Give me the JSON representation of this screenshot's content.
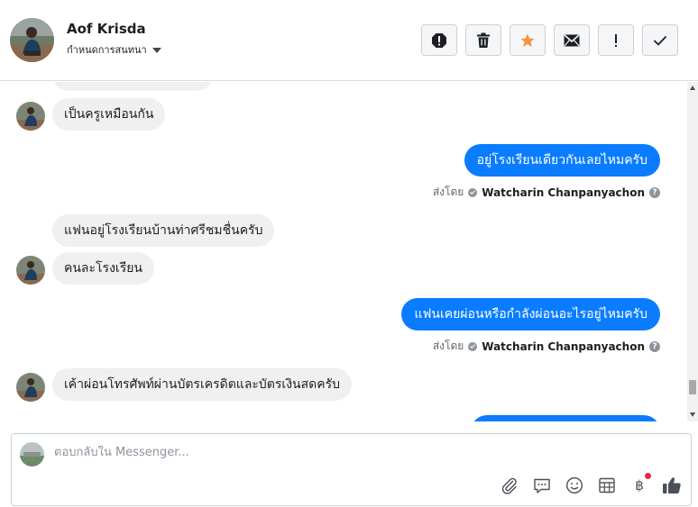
{
  "header": {
    "contact_name": "Aof Krisda",
    "status_label": "กำหนดการสนทนา",
    "toolbar": [
      "spam-icon",
      "trash-icon",
      "star-icon",
      "envelope-icon",
      "exclamation-icon",
      "check-icon"
    ]
  },
  "messages": [
    {
      "direction": "in",
      "text": "เป็นครูเหมือนกัน",
      "show_avatar": true
    },
    {
      "direction": "out",
      "text": "อยู่โรงเรียนเดียวกันเลยไหมครับ",
      "sent_by_label": "ส่งโดย",
      "sent_by_name": "Watcharin Chanpanyachon"
    },
    {
      "direction": "in",
      "text": "แฟนอยู่โรงเรียนบ้านท่าศรีชมชื่นครับ",
      "show_avatar": false
    },
    {
      "direction": "in",
      "text": "คนละโรงเรียน",
      "show_avatar": true
    },
    {
      "direction": "out",
      "text": "แฟนเคยผ่อนหรือกำลังผ่อนอะไรอยู่ไหมครับ",
      "sent_by_label": "ส่งโดย",
      "sent_by_name": "Watcharin Chanpanyachon"
    },
    {
      "direction": "in",
      "text": "เค้าผ่อนโทรศัพท์ผ่านบัตรเครดิตและบัตรเงินสดครับ",
      "show_avatar": true
    }
  ],
  "composer": {
    "placeholder": "ตอบกลับใน Messenger...",
    "icons": [
      "attachment-icon",
      "saved-reply-icon",
      "emoji-icon",
      "appointment-icon",
      "payment-icon",
      "like-icon"
    ],
    "payment_symbol": "฿"
  },
  "colors": {
    "outgoing_bubble": "#0a7cff",
    "incoming_bubble": "#f0f0f0",
    "star": "#f7923b",
    "notification_dot": "#f0284a"
  }
}
